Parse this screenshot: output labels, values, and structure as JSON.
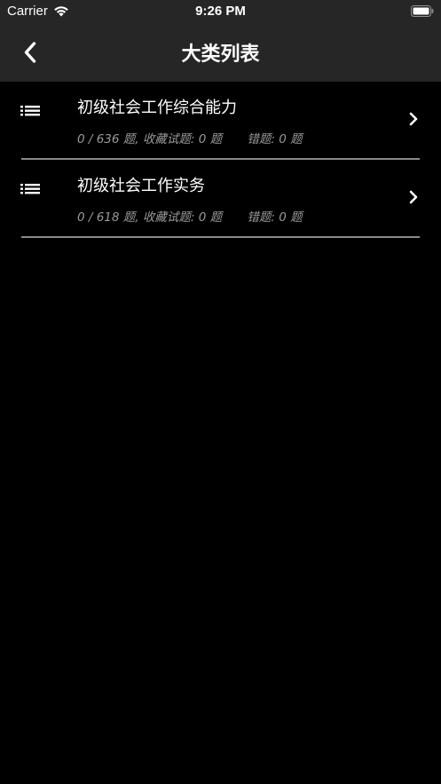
{
  "status_bar": {
    "carrier": "Carrier",
    "time": "9:26 PM"
  },
  "nav": {
    "title": "大类列表",
    "back_icon": "chevron-left-icon"
  },
  "categories": [
    {
      "title": "初级社会工作综合能力",
      "progress": "0 / 636 题,",
      "favorites": "收藏试题: 0 题",
      "wrong": "错题: 0 题"
    },
    {
      "title": "初级社会工作实务",
      "progress": "0 / 618 题,",
      "favorites": "收藏试题: 0 题",
      "wrong": "错题: 0 题"
    }
  ],
  "colors": {
    "background": "#000000",
    "bar_background": "#262626",
    "subtitle": "#9a9a9a",
    "divider": "#8a8a8a"
  }
}
